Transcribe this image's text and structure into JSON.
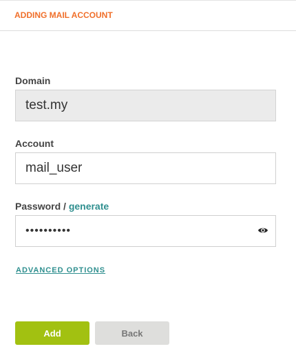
{
  "header": {
    "title": "ADDING MAIL ACCOUNT"
  },
  "form": {
    "domain": {
      "label": "Domain",
      "value": "test.my"
    },
    "account": {
      "label": "Account",
      "value": "mail_user"
    },
    "password": {
      "label": "Password",
      "separator": " / ",
      "generate_label": "generate",
      "value": "••••••••••",
      "toggle_icon": "eye-icon"
    },
    "advanced_options_label": "ADVANCED OPTIONS"
  },
  "buttons": {
    "add_label": "Add",
    "back_label": "Back"
  },
  "colors": {
    "accent_orange": "#f06f2a",
    "link_teal": "#2f8f8f",
    "add_button": "#a2c111",
    "back_button": "#dededc"
  }
}
